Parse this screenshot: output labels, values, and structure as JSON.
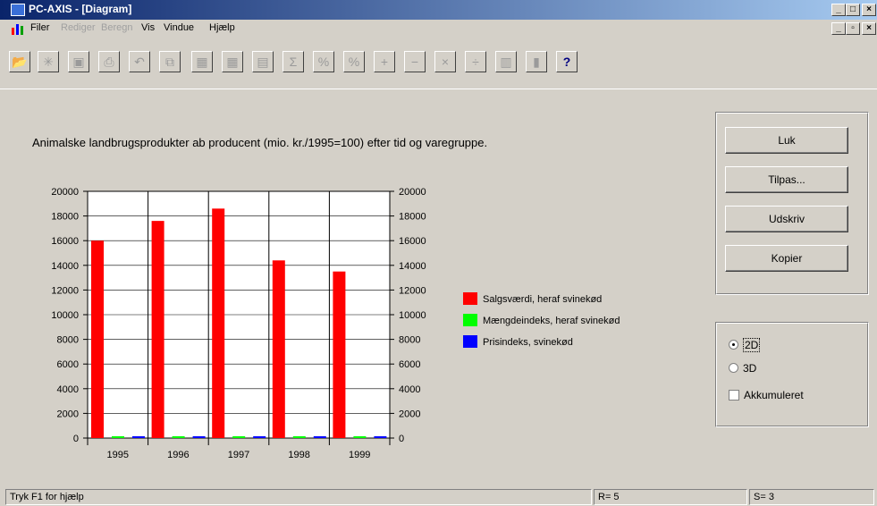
{
  "window": {
    "title": "PC-AXIS - [Diagram]",
    "minimize": "_",
    "maximize": "□",
    "close": "×",
    "restore": "▫"
  },
  "menu": [
    {
      "label": "Filer",
      "enabled": true
    },
    {
      "label": "Rediger",
      "enabled": false
    },
    {
      "label": "Beregn",
      "enabled": false
    },
    {
      "label": "Vis",
      "enabled": true
    },
    {
      "label": "Vindue",
      "enabled": true
    },
    {
      "label": "Hjælp",
      "enabled": true
    }
  ],
  "toolbar": {
    "icons": [
      "open-icon",
      "asterisk-icon",
      "save-icon",
      "print-icon",
      "undo-icon",
      "copy-icon",
      "table-icon",
      "table2-icon",
      "table3-icon",
      "sum-icon",
      "percent-icon",
      "percent2-icon",
      "plus-icon",
      "minus-icon",
      "multiply-icon",
      "divide-icon",
      "columns-icon",
      "chart-icon",
      "help-icon"
    ],
    "glyphs": [
      "📂",
      "✳",
      "▣",
      "⎙",
      "↶",
      "⧉",
      "▦",
      "▦",
      "▤",
      "Σ",
      "%",
      "%",
      "+",
      "−",
      "×",
      "÷",
      "▥",
      "▮",
      "?"
    ]
  },
  "buttons": {
    "close": "Luk",
    "adjust": "Tilpas...",
    "print": "Udskriv",
    "copy": "Kopier"
  },
  "options": {
    "mode_2d": "2D",
    "mode_3d": "3D",
    "selected": "2D",
    "accumulated_label": "Akkumuleret",
    "accumulated_checked": false
  },
  "status": {
    "hint": "Tryk F1 for hjælp",
    "rows": "R= 5",
    "series": "S= 3"
  },
  "chart_data": {
    "type": "bar",
    "title": "Animalske landbrugsprodukter ab producent (mio. kr./1995=100) efter tid og varegruppe.",
    "categories": [
      "1995",
      "1996",
      "1997",
      "1998",
      "1999"
    ],
    "series": [
      {
        "name": "Salgsværdi, heraf svinekød",
        "color": "#ff0000",
        "values": [
          16000,
          17600,
          18600,
          14400,
          13500
        ]
      },
      {
        "name": "Mængdeindeks, heraf svinekød",
        "color": "#00ff00",
        "values": [
          100,
          105,
          110,
          115,
          117
        ]
      },
      {
        "name": "Prisindeks, svinekød",
        "color": "#0000ff",
        "values": [
          100,
          105,
          97,
          73,
          82
        ]
      }
    ],
    "ylim": [
      0,
      20000
    ],
    "yticks": [
      "0",
      "2000",
      "4000",
      "6000",
      "8000",
      "10000",
      "12000",
      "14000",
      "16000",
      "18000",
      "20000"
    ],
    "grid": true,
    "legend": "right"
  }
}
